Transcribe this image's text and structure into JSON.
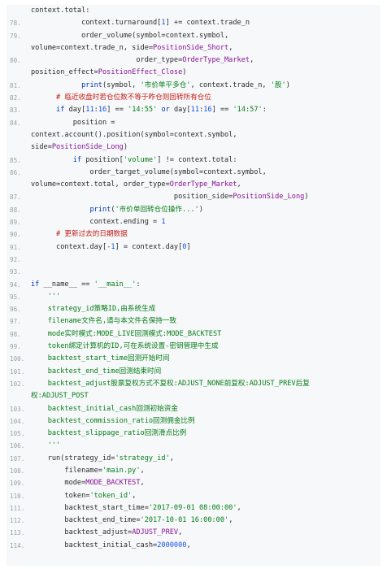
{
  "colors": {
    "background": "#f6f8fa",
    "line_number": "#9aa0a6",
    "keyword": "#0033b3",
    "string": "#067d17",
    "comment": "#c41a16",
    "number": "#1750eb",
    "constant": "#871094"
  },
  "lines": [
    {
      "n": "",
      "code": "context.total:"
    },
    {
      "n": "78.",
      "code": "            context.turnaround[1] += context.trade_n"
    },
    {
      "n": "79.",
      "code": "            order_volume(symbol=context.symbol,"
    },
    {
      "n": "",
      "code": "volume=context.trade_n, side=PositionSide_Short,"
    },
    {
      "n": "80.",
      "code": "                         order_type=OrderType_Market,"
    },
    {
      "n": "",
      "code": "position_effect=PositionEffect_Close)"
    },
    {
      "n": "81.",
      "code": "            print(symbol, '市价单平多仓', context.trade_n, '股')"
    },
    {
      "n": "82.",
      "code": "      # 临近收盘时若仓位数不等于昨仓则回转所有仓位"
    },
    {
      "n": "83.",
      "code": "      if day[11:16] == '14:55' or day[11:16] == '14:57':"
    },
    {
      "n": "84.",
      "code": "          position ="
    },
    {
      "n": "",
      "code": "context.account().position(symbol=context.symbol,"
    },
    {
      "n": "",
      "code": "side=PositionSide_Long)"
    },
    {
      "n": "85.",
      "code": "          if position['volume'] != context.total:"
    },
    {
      "n": "86.",
      "code": "              order_target_volume(symbol=context.symbol,"
    },
    {
      "n": "",
      "code": "volume=context.total, order_type=OrderType_Market,"
    },
    {
      "n": "87.",
      "code": "                                  position_side=PositionSide_Long)"
    },
    {
      "n": "88.",
      "code": "              print('市价单回转仓位操作...')"
    },
    {
      "n": "89.",
      "code": "              context.ending = 1"
    },
    {
      "n": "90.",
      "code": "      # 更新过去的日期数据"
    },
    {
      "n": "91.",
      "code": "      context.day[-1] = context.day[0]"
    },
    {
      "n": "92.",
      "code": ""
    },
    {
      "n": "93.",
      "code": ""
    },
    {
      "n": "94.",
      "code": "if __name__ == '__main__':"
    },
    {
      "n": "95.",
      "code": "    '''"
    },
    {
      "n": "96.",
      "code": "    strategy_id策略ID,由系统生成"
    },
    {
      "n": "97.",
      "code": "    filename文件名,请与本文件名保持一致"
    },
    {
      "n": "98.",
      "code": "    mode实时模式:MODE_LIVE回测模式:MODE_BACKTEST"
    },
    {
      "n": "99.",
      "code": "    token绑定计算机的ID,可在系统设置-密钥管理中生成"
    },
    {
      "n": "100.",
      "code": "    backtest_start_time回测开始时间"
    },
    {
      "n": "101.",
      "code": "    backtest_end_time回测结束时间"
    },
    {
      "n": "102.",
      "code": "    backtest_adjust股票复权方式不复权:ADJUST_NONE前复权:ADJUST_PREV后复"
    },
    {
      "n": "",
      "code": "权:ADJUST_POST"
    },
    {
      "n": "103.",
      "code": "    backtest_initial_cash回测初始资金"
    },
    {
      "n": "104.",
      "code": "    backtest_commission_ratio回测佣金比例"
    },
    {
      "n": "105.",
      "code": "    backtest_slippage_ratio回测滑点比例"
    },
    {
      "n": "106.",
      "code": "    '''"
    },
    {
      "n": "107.",
      "code": "    run(strategy_id='strategy_id',"
    },
    {
      "n": "108.",
      "code": "        filename='main.py',"
    },
    {
      "n": "109.",
      "code": "        mode=MODE_BACKTEST,"
    },
    {
      "n": "110.",
      "code": "        token='token_id',"
    },
    {
      "n": "111.",
      "code": "        backtest_start_time='2017-09-01 08:00:00',"
    },
    {
      "n": "112.",
      "code": "        backtest_end_time='2017-10-01 16:00:00',"
    },
    {
      "n": "113.",
      "code": "        backtest_adjust=ADJUST_PREV,"
    },
    {
      "n": "114.",
      "code": "        backtest_initial_cash=2000000,"
    }
  ]
}
